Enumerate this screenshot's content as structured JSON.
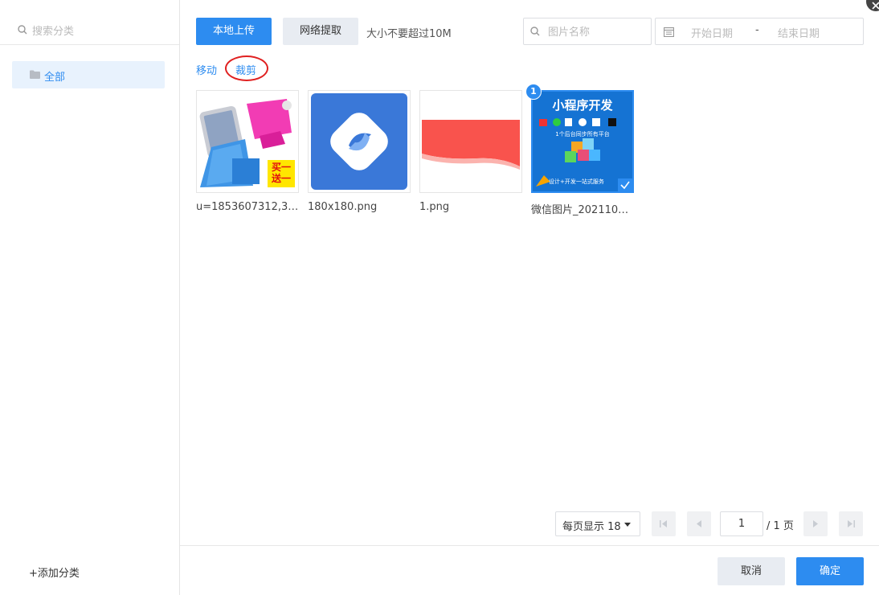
{
  "sidebar": {
    "search_placeholder": "搜索分类",
    "categories": [
      {
        "label": "全部"
      }
    ],
    "add_category": "+添加分类"
  },
  "toolbar": {
    "upload_label": "本地上传",
    "fetch_label": "网络提取",
    "size_hint": "大小不要超过10M",
    "name_search_placeholder": "图片名称",
    "date_start_placeholder": "开始日期",
    "date_separator": "-",
    "date_end_placeholder": "结束日期"
  },
  "actions": {
    "move_label": "移动",
    "crop_label": "裁剪"
  },
  "images": [
    {
      "name": "u=1853607312,39...",
      "badge_text": "买一送一",
      "selected": false
    },
    {
      "name": "180x180.png",
      "selected": false
    },
    {
      "name": "1.png",
      "selected": false
    },
    {
      "name": "微信图片_2021100...",
      "title_text": "小程序开发",
      "sub_text": "1个后台同步所有平台",
      "foot_text": "设计+开发一站式服务",
      "selected": true,
      "selection_index": "1"
    }
  ],
  "pagination": {
    "page_size_label": "每页显示 18",
    "current_page": "1",
    "total_label": "/ 1 页"
  },
  "footer": {
    "cancel_label": "取消",
    "confirm_label": "确定"
  },
  "colors": {
    "primary": "#2d8cf0",
    "selected_bg": "#e8f2fd",
    "annotation": "#e02020"
  }
}
